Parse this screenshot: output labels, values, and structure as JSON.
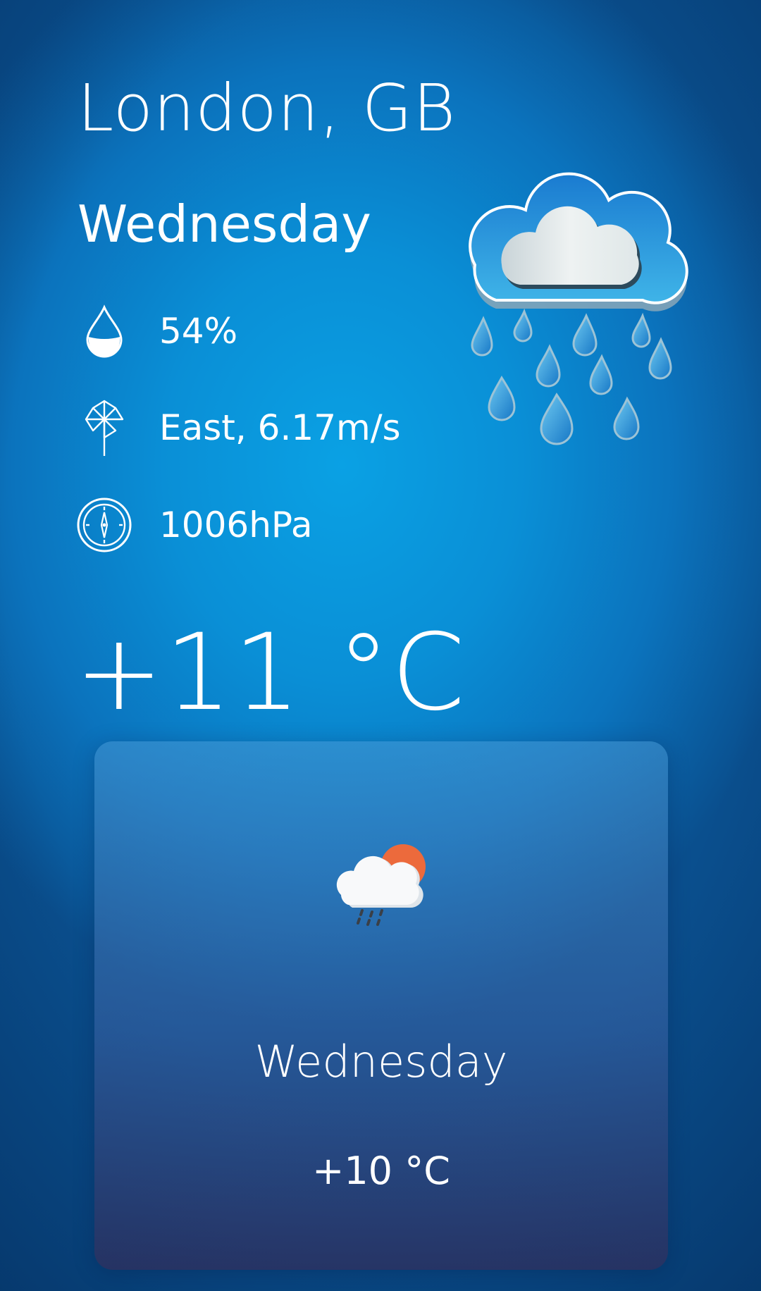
{
  "location": {
    "city": "London, GB"
  },
  "current": {
    "day": "Wednesday",
    "temperature": "+11 °C",
    "condition_icon": "rain-cloud-icon",
    "stats": {
      "humidity": {
        "icon": "water-drop-icon",
        "value": "54%"
      },
      "wind": {
        "icon": "pinwheel-icon",
        "value": "East, 6.17m/s"
      },
      "pressure": {
        "icon": "barometer-icon",
        "value": "1006hPa"
      }
    }
  },
  "forecast": [
    {
      "day": "Wednesday",
      "temperature": "+10 °C",
      "icon": "sun-cloud-rain-icon"
    }
  ],
  "colors": {
    "background_center": "#0aa1e4",
    "background_edge": "#0a4f8e",
    "text": "#ffffff",
    "sun": "#ec6a3c"
  }
}
